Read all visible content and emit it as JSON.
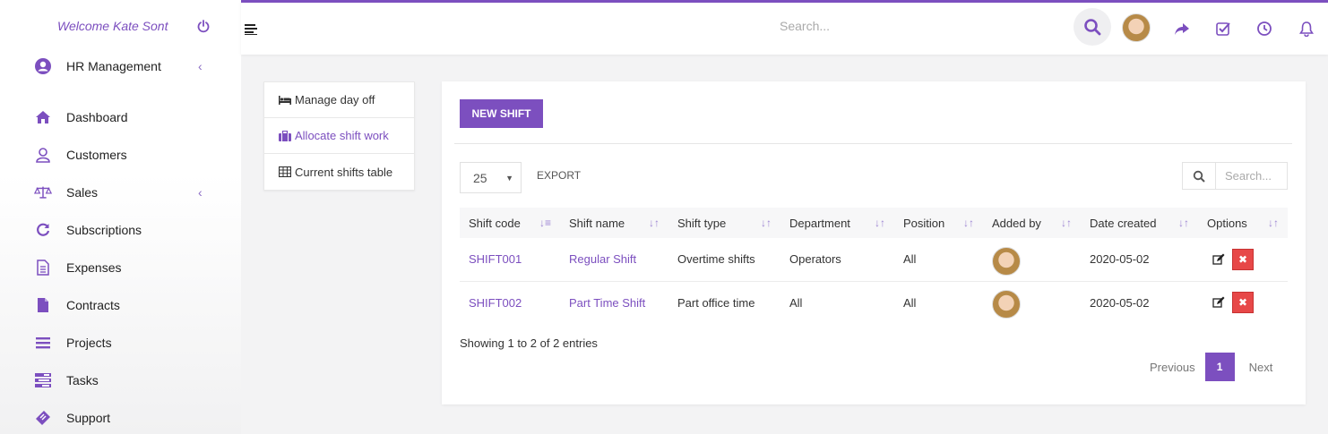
{
  "sidebar": {
    "welcome": "Welcome Kate Sont",
    "items": [
      {
        "label": "HR Management",
        "icon": "user-circle-icon",
        "chevron": "‹"
      },
      {
        "label": "Dashboard",
        "icon": "home-icon"
      },
      {
        "label": "Customers",
        "icon": "user-icon"
      },
      {
        "label": "Sales",
        "icon": "balance-scale-icon",
        "chevron": "‹"
      },
      {
        "label": "Subscriptions",
        "icon": "refresh-icon"
      },
      {
        "label": "Expenses",
        "icon": "file-text-icon"
      },
      {
        "label": "Contracts",
        "icon": "file-icon"
      },
      {
        "label": "Projects",
        "icon": "bars-icon"
      },
      {
        "label": "Tasks",
        "icon": "tasks-icon"
      },
      {
        "label": "Support",
        "icon": "ticket-icon"
      }
    ]
  },
  "topbar": {
    "search_placeholder": "Search..."
  },
  "tabs": [
    {
      "label": "Manage day off",
      "icon": "bed-icon"
    },
    {
      "label": "Allocate shift work",
      "icon": "briefcase-icon"
    },
    {
      "label": "Current shifts table",
      "icon": "table-icon"
    }
  ],
  "card": {
    "new_shift_label": "NEW SHIFT",
    "page_size": "25",
    "export_label": "EXPORT",
    "search_placeholder": "Search...",
    "columns": [
      "Shift code",
      "Shift name",
      "Shift type",
      "Department",
      "Position",
      "Added by",
      "Date created",
      "Options"
    ],
    "rows": [
      {
        "code": "SHIFT001",
        "name": "Regular Shift",
        "type": "Overtime shifts",
        "department": "Operators",
        "position": "All",
        "date": "2020-05-02"
      },
      {
        "code": "SHIFT002",
        "name": "Part Time Shift",
        "type": "Part office time",
        "department": "All",
        "position": "All",
        "date": "2020-05-02"
      }
    ],
    "showing": "Showing 1 to 2 of 2 entries",
    "pager": {
      "previous": "Previous",
      "page": "1",
      "next": "Next"
    }
  },
  "colors": {
    "accent": "#7c4fbf",
    "danger": "#e74848"
  }
}
